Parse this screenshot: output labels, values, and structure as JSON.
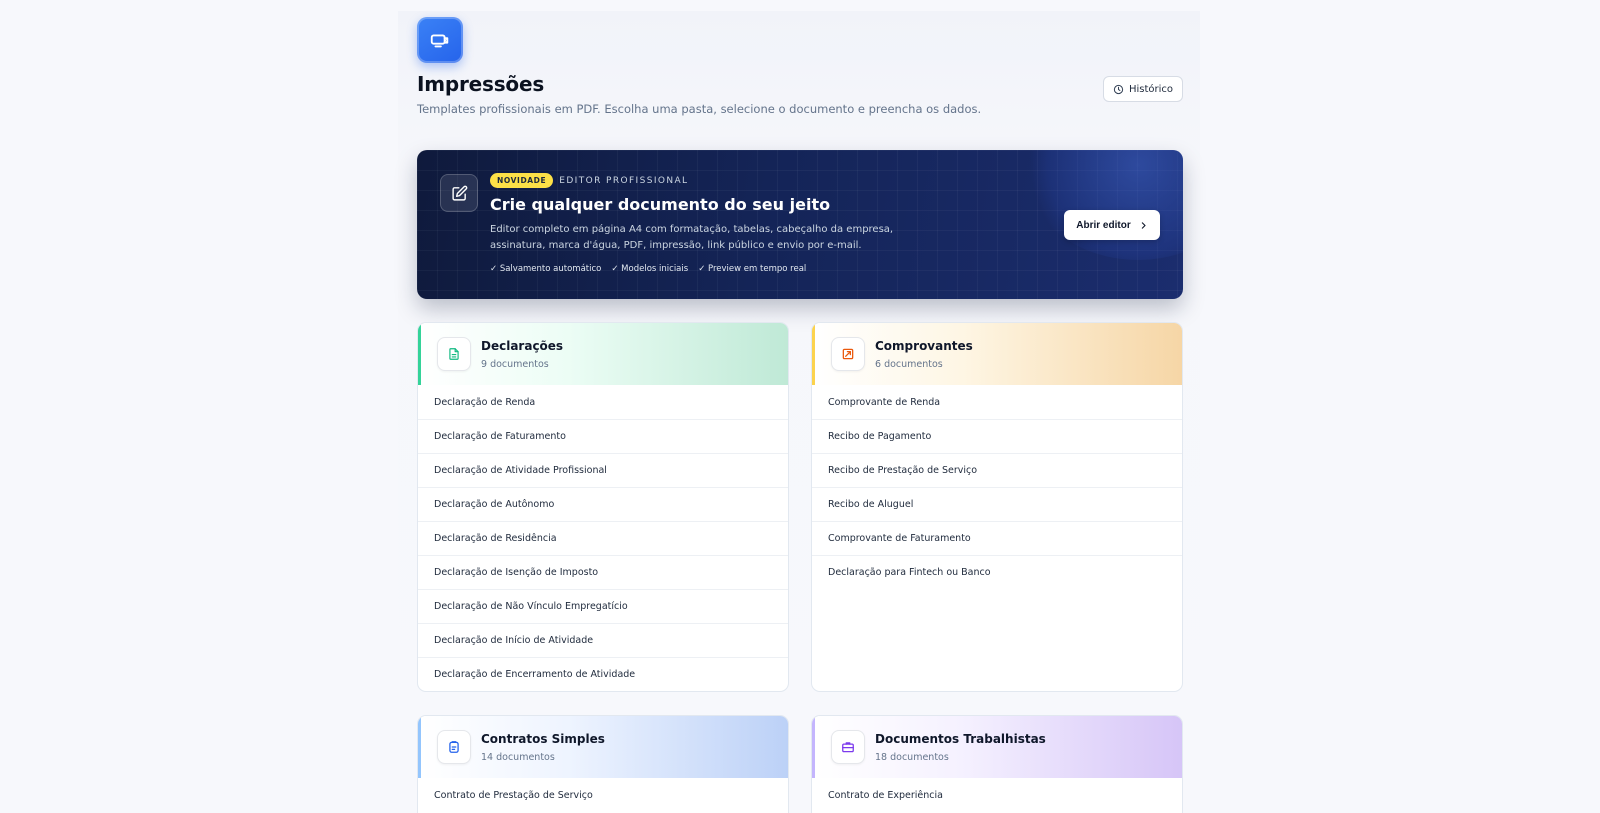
{
  "header": {
    "app_icon": "printer-icon",
    "title": "Impressões",
    "subtitle": "Templates profissionais em PDF. Escolha uma pasta, selecione o documento e preencha os dados.",
    "history_label": "Histórico",
    "history_icon": "clock-icon"
  },
  "banner": {
    "icon": "edit-icon",
    "badge": "NOVIDADE",
    "eyebrow": "EDITOR PROFISSIONAL",
    "title": "Crie qualquer documento do seu jeito",
    "description": "Editor completo em página A4 com formatação, tabelas, cabeçalho da empresa, assinatura, marca d'água, PDF, impressão, link público e envio por e-mail.",
    "features": [
      "✓ Salvamento automático",
      "✓ Modelos iniciais",
      "✓ Preview em tempo real"
    ],
    "cta_label": "Abrir editor"
  },
  "folders": [
    {
      "name": "Declarações",
      "count": "9 documentos",
      "icon": "document-icon",
      "color": "#10b981",
      "items": [
        "Declaração de Renda",
        "Declaração de Faturamento",
        "Declaração de Atividade Profissional",
        "Declaração de Autônomo",
        "Declaração de Residência",
        "Declaração de Isenção de Imposto",
        "Declaração de Não Vínculo Empregatício",
        "Declaração de Início de Atividade",
        "Declaração de Encerramento de Atividade"
      ]
    },
    {
      "name": "Comprovantes",
      "count": "6 documentos",
      "icon": "receipt-icon",
      "color": "#ea580c",
      "items": [
        "Comprovante de Renda",
        "Recibo de Pagamento",
        "Recibo de Prestação de Serviço",
        "Recibo de Aluguel",
        "Comprovante de Faturamento",
        "Declaração para Fintech ou Banco"
      ]
    },
    {
      "name": "Contratos Simples",
      "count": "14 documentos",
      "icon": "contract-icon",
      "color": "#2563eb",
      "items": [
        "Contrato de Prestação de Serviço"
      ]
    },
    {
      "name": "Documentos Trabalhistas",
      "count": "18 documentos",
      "icon": "briefcase-icon",
      "color": "#7c3aed",
      "items": [
        "Contrato de Experiência"
      ]
    }
  ]
}
